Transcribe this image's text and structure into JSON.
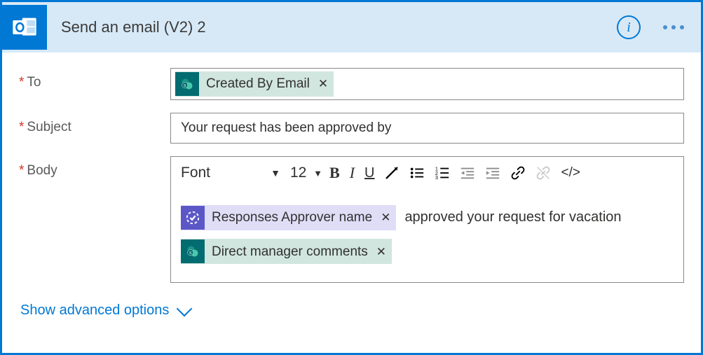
{
  "header": {
    "title": "Send an email (V2) 2",
    "connector": "outlook"
  },
  "fields": {
    "to": {
      "label": "To",
      "required": true,
      "tokens": [
        {
          "source": "sharepoint",
          "label": "Created By Email"
        }
      ]
    },
    "subject": {
      "label": "Subject",
      "required": true,
      "value": "Your request has been approved by"
    },
    "body": {
      "label": "Body",
      "required": true,
      "toolbar": {
        "font_label": "Font",
        "size_label": "12"
      },
      "content": {
        "line1_token": {
          "source": "approvals",
          "label": "Responses Approver name"
        },
        "line1_text": "approved your request for vacation",
        "line2_token": {
          "source": "sharepoint",
          "label": "Direct manager comments"
        }
      }
    }
  },
  "footer": {
    "advanced_label": "Show advanced options"
  }
}
